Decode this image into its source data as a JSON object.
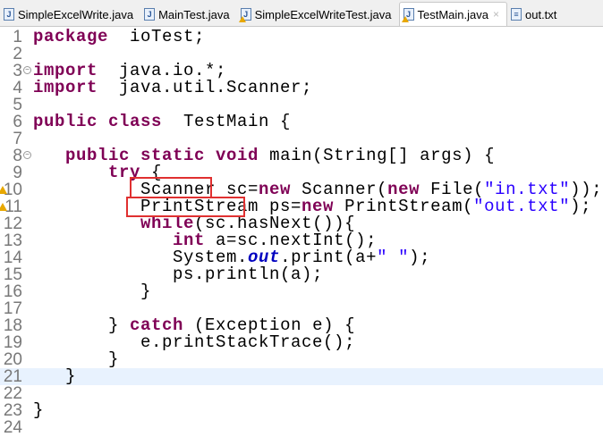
{
  "tabs": [
    {
      "label": "SimpleExcelWrite.java",
      "icon": "java-file-icon",
      "warn": false,
      "active": false
    },
    {
      "label": "MainTest.java",
      "icon": "java-file-icon",
      "warn": false,
      "active": false
    },
    {
      "label": "SimpleExcelWriteTest.java",
      "icon": "java-file-icon",
      "warn": true,
      "active": false
    },
    {
      "label": "TestMain.java",
      "icon": "java-file-icon",
      "warn": true,
      "active": true,
      "close": "×"
    },
    {
      "label": "out.txt",
      "icon": "text-file-icon",
      "warn": false,
      "active": false
    }
  ],
  "editor": {
    "current_line": 21,
    "lines": [
      {
        "n": "1",
        "t": [
          [
            "kw",
            "package"
          ],
          [
            "",
            "  ioTest;"
          ]
        ]
      },
      {
        "n": "2",
        "t": []
      },
      {
        "n": "3",
        "fold": true,
        "t": [
          [
            "kw",
            "import"
          ],
          [
            "",
            "  java.io.*;"
          ]
        ]
      },
      {
        "n": "4",
        "t": [
          [
            "kw",
            "import"
          ],
          [
            "",
            "  java.util.Scanner;"
          ]
        ]
      },
      {
        "n": "5",
        "t": []
      },
      {
        "n": "6",
        "t": [
          [
            "kw",
            "public class"
          ],
          [
            "",
            "  TestMain {"
          ]
        ]
      },
      {
        "n": "7",
        "t": []
      },
      {
        "n": "8",
        "fold": true,
        "t": [
          [
            "",
            "   "
          ],
          [
            "kw",
            "public static void"
          ],
          [
            "",
            " main(String[] args) {"
          ]
        ]
      },
      {
        "n": "9",
        "t": [
          [
            "",
            "       "
          ],
          [
            "kw",
            "try"
          ],
          [
            "",
            " {"
          ]
        ]
      },
      {
        "n": "10",
        "warn": true,
        "t": [
          [
            "",
            "          Scanner sc="
          ],
          [
            "kw",
            "new"
          ],
          [
            "",
            " Scanner("
          ],
          [
            "kw",
            "new"
          ],
          [
            "",
            " File("
          ],
          [
            "str",
            "\"in.txt\""
          ],
          [
            "",
            "));"
          ]
        ]
      },
      {
        "n": "11",
        "warn": true,
        "t": [
          [
            "",
            "          PrintStream ps="
          ],
          [
            "kw",
            "new"
          ],
          [
            "",
            " PrintStream("
          ],
          [
            "str",
            "\"out.txt\""
          ],
          [
            "",
            ");"
          ]
        ]
      },
      {
        "n": "12",
        "t": [
          [
            "",
            "          "
          ],
          [
            "kw",
            "while"
          ],
          [
            "",
            "(sc.hasNext()){"
          ]
        ]
      },
      {
        "n": "13",
        "t": [
          [
            "",
            "             "
          ],
          [
            "kw",
            "int"
          ],
          [
            "",
            " a=sc.nextInt();"
          ]
        ]
      },
      {
        "n": "14",
        "t": [
          [
            "",
            "             System."
          ],
          [
            "fld",
            "out"
          ],
          [
            "",
            ".print(a+"
          ],
          [
            "str",
            "\" \""
          ],
          [
            "",
            ");"
          ]
        ]
      },
      {
        "n": "15",
        "t": [
          [
            "",
            "             ps.println(a);"
          ]
        ]
      },
      {
        "n": "16",
        "t": [
          [
            "",
            "          }"
          ]
        ]
      },
      {
        "n": "17",
        "t": []
      },
      {
        "n": "18",
        "t": [
          [
            "",
            "       } "
          ],
          [
            "kw",
            "catch"
          ],
          [
            "",
            " (Exception e) {"
          ]
        ]
      },
      {
        "n": "19",
        "t": [
          [
            "",
            "          e.printStackTrace();"
          ]
        ]
      },
      {
        "n": "20",
        "t": [
          [
            "",
            "       }"
          ]
        ]
      },
      {
        "n": "21",
        "t": [
          [
            "",
            "   }"
          ]
        ]
      },
      {
        "n": "22",
        "t": []
      },
      {
        "n": "23",
        "t": [
          [
            "",
            "}"
          ]
        ]
      },
      {
        "n": "24",
        "t": []
      }
    ]
  },
  "colors": {
    "keyword": "#7f0055",
    "string": "#2a00ff",
    "highlight_box": "#e03030",
    "current_line": "#e8f2fe"
  }
}
